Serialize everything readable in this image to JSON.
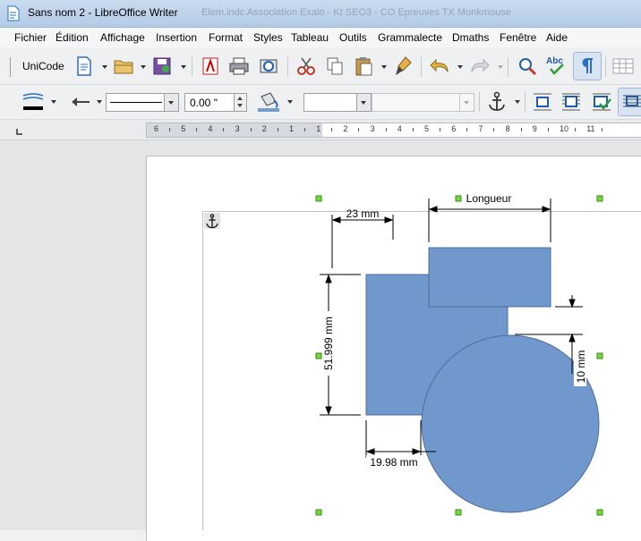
{
  "window": {
    "title": "Sans nom 2 - LibreOffice Writer",
    "background_tabs": "Elem.indc   Association Exalo - Kt   SEO3 - CO   Epreuves   TX   Monkmouse"
  },
  "menu": [
    "Fichier",
    "Édition",
    "Affichage",
    "Insertion",
    "Format",
    "Styles",
    "Tableau",
    "Outils",
    "Grammalecte",
    "Dmaths",
    "Fenêtre",
    "Aide"
  ],
  "toolbar1": {
    "unicode_label": "UniCode"
  },
  "toolbar2": {
    "line_width_value": "0.00 \""
  },
  "ruler": {
    "ticks": [
      "6",
      "5",
      "4",
      "3",
      "2",
      "1",
      "1",
      "2",
      "3",
      "4",
      "5",
      "6",
      "7",
      "8",
      "9",
      "10",
      "11"
    ]
  },
  "drawing": {
    "dim_longueur": "Longueur",
    "dim_23": "23 mm",
    "dim_51": "51.999 mm",
    "dim_10": "10 mm",
    "dim_19": "19.98 mm"
  },
  "colors": {
    "shape_fill": "#7098cc",
    "shape_stroke": "#4b6c9d",
    "handle": "#6fdc35"
  }
}
